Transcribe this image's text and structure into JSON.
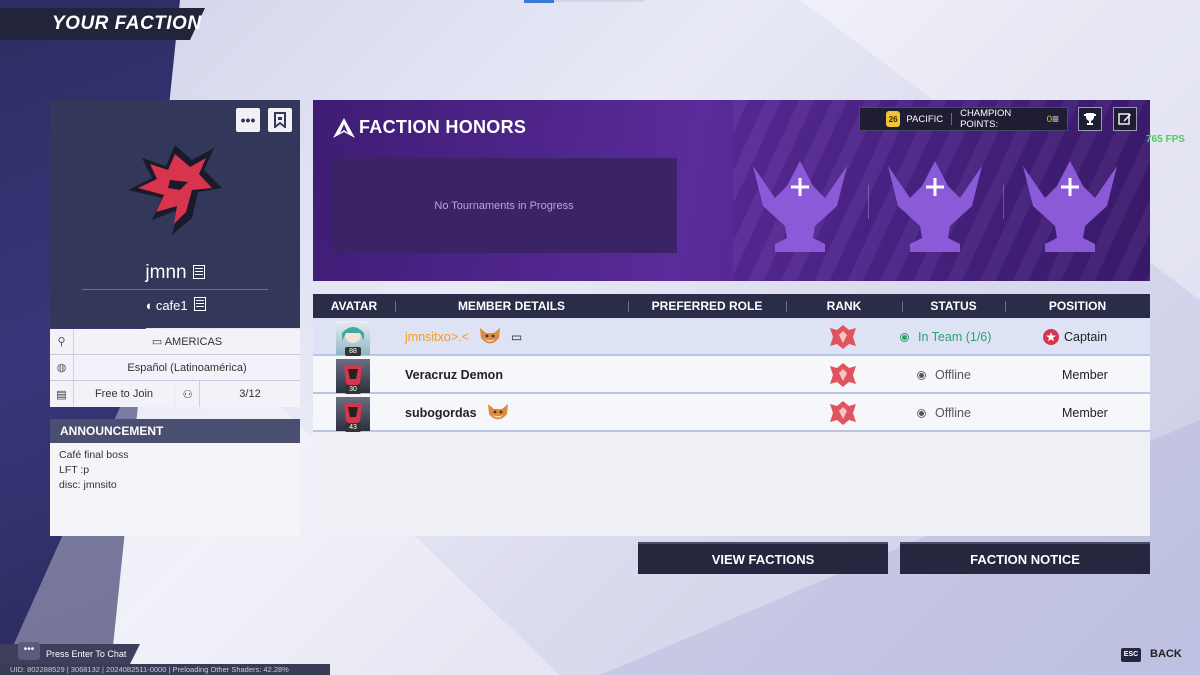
{
  "screen": {
    "title": "YOUR FACTION",
    "fps": "765 FPS"
  },
  "profile": {
    "name": "jmnn",
    "tag": "cafe1",
    "region": "AMERICAS",
    "language": "Español (Latinoamérica)",
    "join_type": "Free to Join",
    "members": "3/12",
    "icons": [
      "more-options-icon",
      "bookmark-flag-icon",
      "dragon-logo-icon"
    ]
  },
  "announcement": {
    "heading": "ANNOUNCEMENT",
    "lines": [
      "Café final boss",
      "LFT :p",
      "disc: jmnsito"
    ]
  },
  "honors": {
    "title": "FACTION HONORS",
    "no_tournaments": "No Tournaments in Progress",
    "level": "26",
    "region": "PACIFIC",
    "champion_label": "CHAMPION POINTS:",
    "champion_value": "0",
    "colors": {
      "panel": "#4a2386",
      "accent": "#f0c436"
    }
  },
  "table": {
    "headers": [
      "AVATAR",
      "MEMBER DETAILS",
      "PREFERRED ROLE",
      "RANK",
      "STATUS",
      "POSITION"
    ],
    "rows": [
      {
        "level": "88",
        "name": "jmnsitxo>.<",
        "status": "In Team (1/6)",
        "position": "Captain"
      },
      {
        "level": "30",
        "name": "Veracruz Demon",
        "status": "Offline",
        "position": "Member"
      },
      {
        "level": "43",
        "name": "subogordas",
        "status": "Offline",
        "position": "Member"
      }
    ]
  },
  "buttons": {
    "view_factions": "VIEW FACTIONS",
    "faction_notice": "FACTION NOTICE"
  },
  "footer": {
    "chat": "Press Enter To Chat",
    "uid": "UID: 802288529 | 3068132 | 2024082511-0000 |",
    "shaders": "Preloading Other Shaders: 42.28%",
    "esc": "ESC",
    "back": "BACK"
  }
}
